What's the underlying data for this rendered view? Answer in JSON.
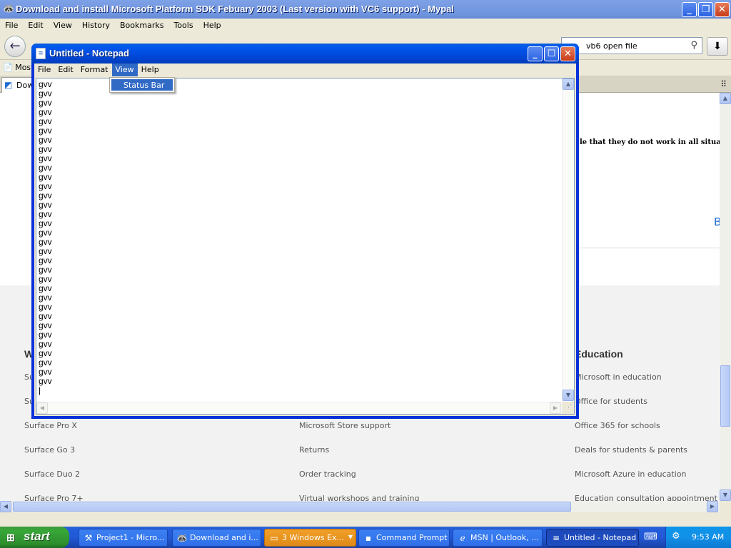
{
  "browser": {
    "title": "Download and install Microsoft Platform SDK Febuary 2003 (Last version with VC6 support) - Mypal",
    "icon": "mypal-raccoon-icon",
    "menu": [
      "File",
      "Edit",
      "View",
      "History",
      "Bookmarks",
      "Tools",
      "Help"
    ],
    "search_value": "vb6 open file",
    "bookmarks_label": "Most",
    "tab_label": "Dow",
    "page": {
      "note": "le that they do not work in all situations.",
      "partial_link": "B",
      "footer": {
        "col1": {
          "head": "W",
          "links": [
            "Su",
            "Su",
            "Surface Pro X",
            "Surface Go 3",
            "Surface Duo 2",
            "Surface Pro 7+"
          ]
        },
        "col2": {
          "links": [
            "Microsoft Store support",
            "Returns",
            "Order tracking",
            "Virtual workshops and training"
          ]
        },
        "col3": {
          "head": "Education",
          "links": [
            "Microsoft in education",
            "Office for students",
            "Office 365 for schools",
            "Deals for students & parents",
            "Microsoft Azure in education",
            "Education consultation appointment"
          ]
        }
      }
    }
  },
  "notepad": {
    "title": "Untitled - Notepad",
    "menu": [
      "File",
      "Edit",
      "Format",
      "View",
      "Help"
    ],
    "open_menu": "View",
    "dropdown_items": [
      "Status Bar"
    ],
    "line_text": "gvv",
    "line_count": 33
  },
  "taskbar": {
    "start_label": "start",
    "tasks": [
      {
        "label": "Project1 - Micro...",
        "icon": "vb6-icon"
      },
      {
        "label": "Download and i...",
        "icon": "mypal-icon"
      },
      {
        "label": "3 Windows Ex...",
        "icon": "folder-icon"
      },
      {
        "label": "Command Prompt",
        "icon": "cmd-icon"
      },
      {
        "label": "MSN | Outlook, ...",
        "icon": "ie-icon"
      },
      {
        "label": "Untitled - Notepad",
        "icon": "notepad-icon"
      }
    ],
    "clock": "9:53 AM"
  },
  "colors": {
    "xp_title_blue": "#0055E5",
    "selection_blue": "#316AC5",
    "start_green": "#37A737",
    "taskbar_blue": "#245EDC"
  }
}
